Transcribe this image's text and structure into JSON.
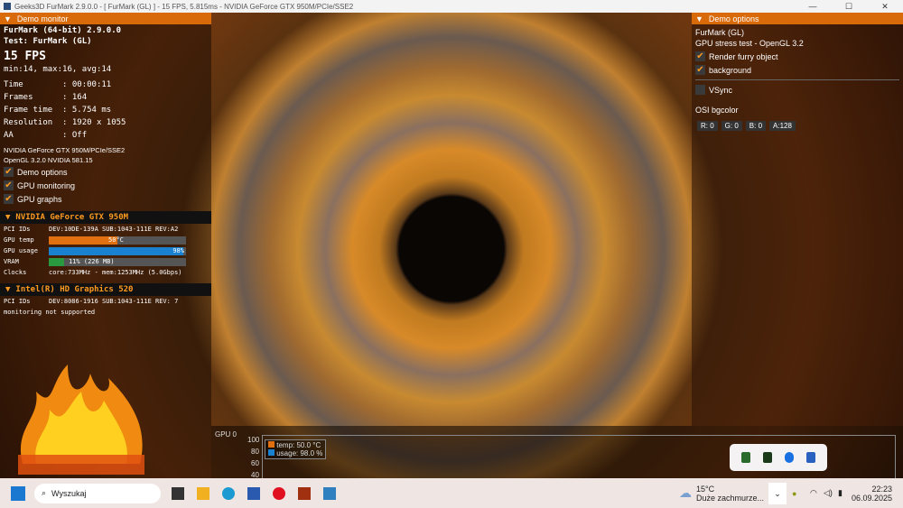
{
  "window": {
    "title": "Geeks3D FurMark 2.9.0.0 - [ FurMark (GL) ] - 15 FPS, 5.815ms - NVIDIA GeForce GTX 950M/PCIe/SSE2",
    "min": "—",
    "max": "☐",
    "close": "✕"
  },
  "demo_monitor": {
    "header": "Demo monitor",
    "app": "FurMark (64-bit) 2.9.0.0",
    "test": "Test: FurMark (GL)",
    "fps": "15 FPS",
    "fps_stats": "min:14, max:16, avg:14",
    "stats": [
      "Time        : 00:00:11",
      "Frames      : 164",
      "Frame time  : 5.754 ms",
      "Resolution  : 1920 x 1055",
      "AA          : Off"
    ],
    "gpu_name": "NVIDIA GeForce GTX 950M/PCIe/SSE2",
    "opengl": "OpenGL 3.2.0 NVIDIA 581.15",
    "checks": [
      "Demo options",
      "GPU monitoring",
      "GPU graphs"
    ]
  },
  "gpu0": {
    "name": "NVIDIA GeForce GTX 950M",
    "pci_label": "PCI IDs",
    "pci": "DEV:10DE-139A SUB:1043-111E REV:A2",
    "temp_label": "GPU temp",
    "temp": "50°C",
    "temp_pct": 50,
    "usage_label": "GPU usage",
    "usage": "98%",
    "usage_pct": 98,
    "vram_label": "VRAM",
    "vram": "11% (226 MB)",
    "vram_pct": 11,
    "clocks_label": "Clocks",
    "clocks": "core:733MHz - mem:1253MHz (5.0Gbps)"
  },
  "gpu1": {
    "name": "Intel(R) HD Graphics 520",
    "pci_label": "PCI IDs",
    "pci": "DEV:8086-1916 SUB:1043-111E REV: 7",
    "note": "monitoring not supported"
  },
  "logo": "FURMARK",
  "demo_options": {
    "header": "Demo options",
    "title": "FurMark (GL)",
    "subtitle": "GPU stress test - OpenGL 3.2",
    "render": "Render furry object",
    "background": "background",
    "vsync": "VSync",
    "bgcolor_label": "OSI bgcolor",
    "r": "R: 0",
    "g": "G: 0",
    "b": "B: 0",
    "a": "A:128"
  },
  "graph": {
    "label": "GPU 0",
    "ticks": [
      "100",
      "80",
      "60",
      "40"
    ],
    "legend_temp": "temp: 50.0 °C",
    "legend_usage": "usage: 98.0 %",
    "temp_color": "#e07010",
    "usage_color": "#1a80d0"
  },
  "taskbar": {
    "search": "Wyszukaj",
    "weather_temp": "15°C",
    "weather_desc": "Duże zachmurze...",
    "time": "22:23",
    "date": "06.09.2025"
  }
}
